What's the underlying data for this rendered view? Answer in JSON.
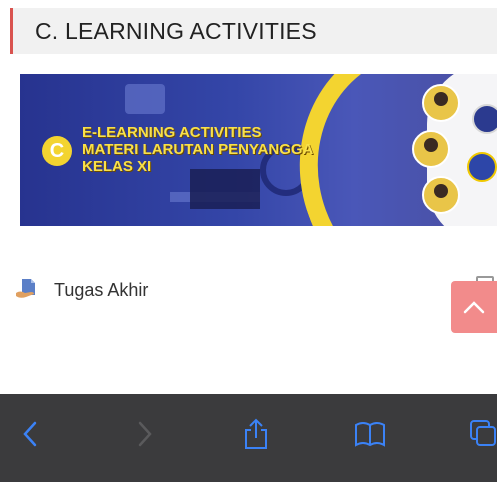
{
  "section": {
    "title": "C. LEARNING ACTIVITIES"
  },
  "banner": {
    "line1": "E-LEARNING ACTIVITIES",
    "line2": "MATERI LARUTAN PENYANGGA",
    "line3": "KELAS XI",
    "logo_letter": "C"
  },
  "activity": {
    "label": "Tugas Akhir",
    "icon": "assignment-icon"
  },
  "toolbar": {
    "back_icon": "chevron-left-icon",
    "forward_icon": "chevron-right-icon",
    "share_icon": "share-icon",
    "bookmarks_icon": "book-icon",
    "tabs_icon": "tabs-icon"
  },
  "colors": {
    "accent": "#d9534f",
    "banner_blue": "#2f3f9e",
    "banner_yellow": "#f3d430",
    "toolbar_bg": "#3b3b3d",
    "toolbar_active": "#3b82f6",
    "scroll_top_bg": "#f28b8b"
  }
}
